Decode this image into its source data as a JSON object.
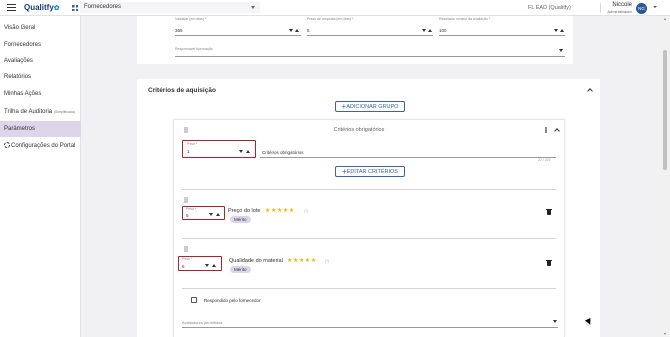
{
  "header": {
    "logo": "Qualitfy",
    "logo_symbol": "✿",
    "module": "Fornecedores",
    "company": "FL EAD (Qualitfy)",
    "user_name": "Niccole",
    "user_role": "Administrador",
    "avatar_initials": "NG"
  },
  "sidebar": {
    "items": [
      {
        "label": "Visão Geral"
      },
      {
        "label": "Fornecedores"
      },
      {
        "label": "Avaliações"
      },
      {
        "label": "Relatórios"
      },
      {
        "label": "Minhas Ações"
      },
      {
        "label": "Trilha de Auditoria",
        "badge": "(Simplificada)"
      },
      {
        "label": "Parâmetros",
        "active": true
      },
      {
        "label": "Configurações do Portal"
      }
    ]
  },
  "params_card": {
    "validity": {
      "label": "Validade (em dias) *",
      "value": "365"
    },
    "response_deadline": {
      "label": "Prazo de resposta (em dias) *",
      "value": "5"
    },
    "min_score": {
      "label": "Resultado mínimo da avaliação *",
      "value": "100"
    },
    "approval_responsible": {
      "label": "Responsável Aprovação",
      "value": ""
    }
  },
  "criteria_section": {
    "title": "Critérios de aquisição",
    "add_group_button": "ADICIONAR GRUPO",
    "group": {
      "title": "Critérios obrigatórios",
      "weight_label": "Peso *",
      "weight_value": "1",
      "name_value": "Critérios obrigatórios",
      "counter": "22 / 200",
      "edit_button": "EDITAR CRITÉRIOS"
    },
    "criteria": [
      {
        "weight_label": "Peso *",
        "weight_value": "5",
        "name": "Preço do lote",
        "stars": "★★★★★",
        "help": "(?)",
        "chip": "Mérito"
      },
      {
        "weight_label": "Peso *",
        "weight_value": "5",
        "name": "Qualidade do material",
        "stars": "★★★★★",
        "help": "(?)",
        "chip": "Mérito"
      }
    ],
    "answered_by_supplier": "Respondido pelo fornecedor",
    "allowed_evaluators_label": "Avaliadores permitidos"
  },
  "colors": {
    "accent": "#3a63a8",
    "highlight_border": "#b32025",
    "active_nav": "#dcd6ea",
    "star": "#f0b400"
  }
}
